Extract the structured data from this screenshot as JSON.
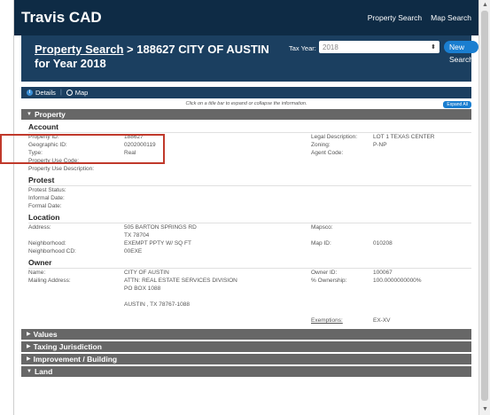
{
  "app": {
    "brand": "Travis CAD",
    "nav_links": [
      "Property Search",
      "Map Search"
    ]
  },
  "header": {
    "breadcrumb_link": "Property Search",
    "title_rest": " > 188627 CITY OF AUSTIN for Year 2018",
    "tax_year_label": "Tax Year:",
    "tax_year_value": "2018",
    "new_search": "New Search"
  },
  "tabs": [
    {
      "icon": "info-icon",
      "label": "Details"
    },
    {
      "icon": "globe-icon",
      "label": "Map"
    }
  ],
  "hint": "Click on a title bar to expand or collapse the information.",
  "expand_all": "Expand All",
  "property": {
    "section_title": "Property",
    "account": {
      "heading": "Account",
      "rows": [
        {
          "l1": "Property ID:",
          "v1": "188627",
          "l2": "Legal Description:",
          "v2": "LOT 1 TEXAS CENTER"
        },
        {
          "l1": "Geographic ID:",
          "v1": "0202000119",
          "l2": "Zoning:",
          "v2": "P-NP"
        },
        {
          "l1": "Type:",
          "v1": "Real",
          "l2": "Agent Code:",
          "v2": ""
        },
        {
          "l1": "Property Use Code:",
          "v1": "",
          "l2": "",
          "v2": ""
        },
        {
          "l1": "Property Use Description:",
          "v1": "",
          "l2": "",
          "v2": ""
        }
      ]
    },
    "protest": {
      "heading": "Protest",
      "rows": [
        {
          "l1": "Protest Status:"
        },
        {
          "l1": "Informal Date:"
        },
        {
          "l1": "Formal Date:"
        }
      ]
    },
    "location": {
      "heading": "Location",
      "rows": [
        {
          "l1": "Address:",
          "v1": "505 BARTON SPRINGS RD",
          "l2": "Mapsco:",
          "v2": ""
        },
        {
          "l1": "",
          "v1": "TX 78704",
          "l2": "",
          "v2": ""
        },
        {
          "l1": "Neighborhood:",
          "v1": "EXEMPT PPTY W/ SQ FT",
          "l2": "Map ID:",
          "v2": "010208"
        },
        {
          "l1": "Neighborhood CD:",
          "v1": "00EXE",
          "l2": "",
          "v2": ""
        }
      ]
    },
    "owner": {
      "heading": "Owner",
      "rows": [
        {
          "l1": "Name:",
          "v1": "CITY OF AUSTIN",
          "l2": "Owner ID:",
          "v2": "100067"
        },
        {
          "l1": "Mailing Address:",
          "v1": "ATTN: REAL ESTATE SERVICES DIVISION",
          "l2": "% Ownership:",
          "v2": "100.0000000000%"
        },
        {
          "l1": "",
          "v1": "PO BOX 1088",
          "l2": "",
          "v2": ""
        },
        {
          "l1": "",
          "v1": "",
          "l2": "",
          "v2": ""
        },
        {
          "l1": "",
          "v1": "AUSTIN , TX 78767-1088",
          "l2": "",
          "v2": ""
        },
        {
          "l1": "",
          "v1": "",
          "l2": "",
          "v2": ""
        },
        {
          "l1": "",
          "v1": "",
          "l2": "Exemptions:",
          "v2": "EX-XV"
        }
      ]
    }
  },
  "collapsed_sections": [
    "Values",
    "Taxing Jurisdiction",
    "Improvement / Building"
  ],
  "last_section": "Land"
}
